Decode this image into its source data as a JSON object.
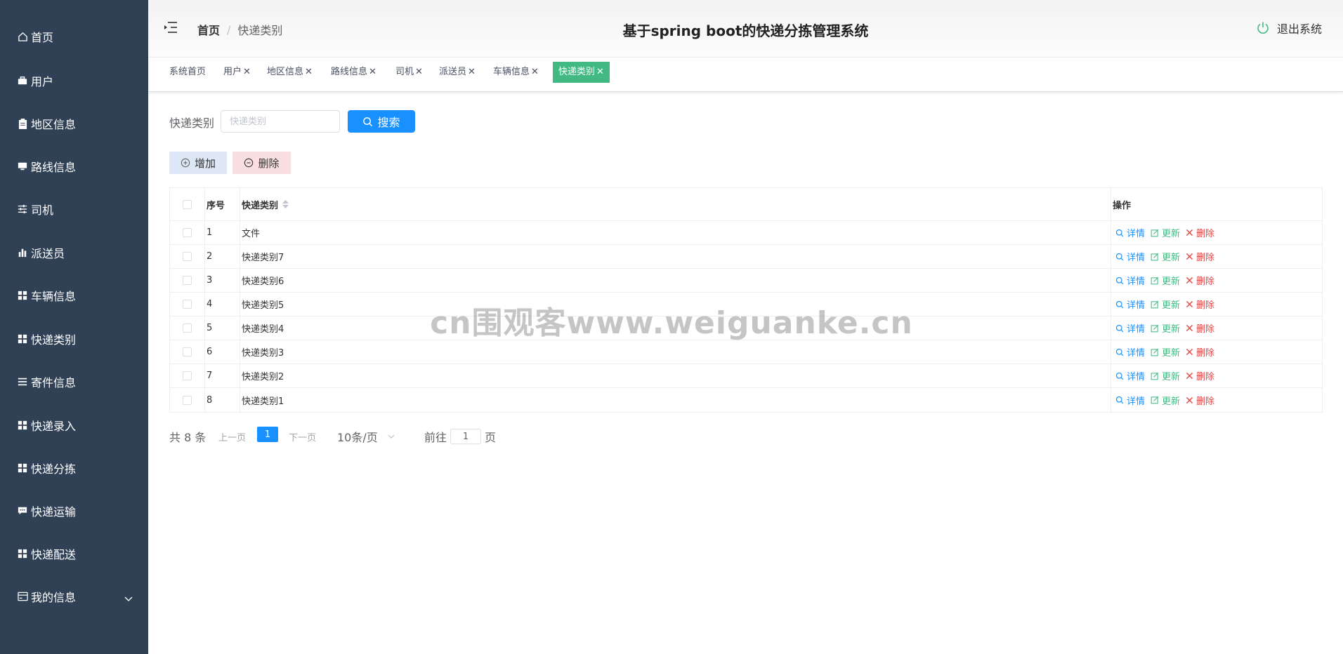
{
  "sidebar": {
    "items": [
      {
        "label": "首页",
        "icon": "home-icon"
      },
      {
        "label": "用户",
        "icon": "briefcase-icon"
      },
      {
        "label": "地区信息",
        "icon": "clipboard-icon"
      },
      {
        "label": "路线信息",
        "icon": "monitor-icon"
      },
      {
        "label": "司机",
        "icon": "sliders-icon"
      },
      {
        "label": "派送员",
        "icon": "bar-chart-icon"
      },
      {
        "label": "车辆信息",
        "icon": "grid-icon"
      },
      {
        "label": "快递类别",
        "icon": "grid-icon"
      },
      {
        "label": "寄件信息",
        "icon": "list-icon"
      },
      {
        "label": "快递录入",
        "icon": "grid-icon"
      },
      {
        "label": "快递分拣",
        "icon": "grid-icon"
      },
      {
        "label": "快递运输",
        "icon": "message-icon"
      },
      {
        "label": "快递配送",
        "icon": "grid-icon"
      },
      {
        "label": "我的信息",
        "icon": "card-icon"
      }
    ]
  },
  "header": {
    "breadcrumb_home": "首页",
    "breadcrumb_sep": "/",
    "breadcrumb_current": "快递类别",
    "title": "基于spring boot的快递分拣管理系统",
    "logout_label": "退出系统"
  },
  "tags": [
    {
      "label": "系统首页",
      "closable": false,
      "active": false
    },
    {
      "label": "用户",
      "closable": true,
      "active": false
    },
    {
      "label": "地区信息",
      "closable": true,
      "active": false
    },
    {
      "label": "路线信息",
      "closable": true,
      "active": false
    },
    {
      "label": "司机",
      "closable": true,
      "active": false
    },
    {
      "label": "派送员",
      "closable": true,
      "active": false
    },
    {
      "label": "车辆信息",
      "closable": true,
      "active": false
    },
    {
      "label": "快递类别",
      "closable": true,
      "active": true
    }
  ],
  "tag_close_glyph": "✕",
  "search": {
    "label": "快递类别",
    "placeholder": "快递类别",
    "button_label": "搜索"
  },
  "actions": {
    "add_label": "增加",
    "delete_label": "删除"
  },
  "table": {
    "headers": {
      "index": "序号",
      "name": "快递类别",
      "ops": "操作"
    },
    "op_labels": {
      "detail": "详情",
      "update": "更新",
      "remove": "删除"
    },
    "rows": [
      {
        "index": "1",
        "name": "文件"
      },
      {
        "index": "2",
        "name": "快递类别7"
      },
      {
        "index": "3",
        "name": "快递类别6"
      },
      {
        "index": "4",
        "name": "快递类别5"
      },
      {
        "index": "5",
        "name": "快递类别4"
      },
      {
        "index": "6",
        "name": "快递类别3"
      },
      {
        "index": "7",
        "name": "快递类别2"
      },
      {
        "index": "8",
        "name": "快递类别1"
      }
    ]
  },
  "pagination": {
    "total": "共 8 条",
    "prev": "上一页",
    "current_page": "1",
    "next": "下一页",
    "page_size": "10条/页",
    "goto_label": "前往",
    "goto_value": "1",
    "goto_unit": "页"
  },
  "watermark": "cn围观客www.weiguanke.cn",
  "colors": {
    "sidebar_bg": "#304156",
    "primary": "#1890ff",
    "active_tag": "#42b983",
    "danger": "#e04848"
  }
}
